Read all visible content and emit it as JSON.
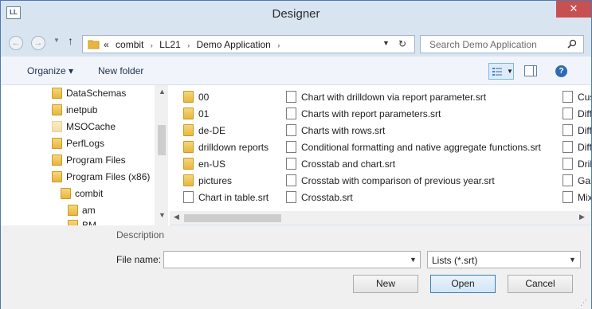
{
  "window": {
    "title": "Designer",
    "app_icon_text": "LL",
    "close_glyph": "✕"
  },
  "nav": {
    "back_glyph": "←",
    "forward_glyph": "→",
    "recent_glyph": "▼",
    "up_glyph": "↑",
    "breadcrumb_overflow": "«",
    "breadcrumb": [
      "combit",
      "LL21",
      "Demo Application"
    ],
    "breadcrumb_sep": "›",
    "dropdown_glyph": "▼",
    "refresh_glyph": "↻",
    "search_placeholder": "Search Demo Application"
  },
  "toolbar": {
    "organize_label": "Organize ▾",
    "new_folder_label": "New folder",
    "view_dropdown_glyph": "▼",
    "help_glyph": "?"
  },
  "navpane": {
    "items": [
      {
        "label": "DataSchemas",
        "icon": "folder-icon"
      },
      {
        "label": "inetpub",
        "icon": "folder-icon"
      },
      {
        "label": "MSOCache",
        "icon": "folder-faded-icon"
      },
      {
        "label": "PerfLogs",
        "icon": "folder-icon"
      },
      {
        "label": "Program Files",
        "icon": "folder-icon"
      },
      {
        "label": "Program Files (x86)",
        "icon": "folder-icon"
      },
      {
        "label": "combit",
        "icon": "folder-icon"
      },
      {
        "label": "am",
        "icon": "folder-icon"
      },
      {
        "label": "BM",
        "icon": "folder-icon"
      }
    ],
    "scroll_up_glyph": "▲",
    "scroll_down_glyph": "▼"
  },
  "files": {
    "column1": [
      {
        "label": "00",
        "icon": "folder-icon"
      },
      {
        "label": "01",
        "icon": "folder-icon"
      },
      {
        "label": "de-DE",
        "icon": "folder-icon"
      },
      {
        "label": "drilldown reports",
        "icon": "folder-icon"
      },
      {
        "label": "en-US",
        "icon": "folder-icon"
      },
      {
        "label": "pictures",
        "icon": "folder-icon"
      },
      {
        "label": "Chart in table.srt",
        "icon": "document-icon"
      }
    ],
    "column2": [
      {
        "label": "Chart with drilldown via report parameter.srt",
        "icon": "document-icon"
      },
      {
        "label": "Charts with report parameters.srt",
        "icon": "document-icon"
      },
      {
        "label": "Charts with rows.srt",
        "icon": "document-icon"
      },
      {
        "label": "Conditional formatting and native aggregate functions.srt",
        "icon": "document-icon"
      },
      {
        "label": "Crosstab and chart.srt",
        "icon": "document-icon"
      },
      {
        "label": "Crosstab with comparison of previous year.srt",
        "icon": "document-icon"
      },
      {
        "label": "Crosstab.srt",
        "icon": "document-icon"
      }
    ],
    "column3": [
      {
        "label": "Cust",
        "icon": "document-icon"
      },
      {
        "label": "Diffe",
        "icon": "document-icon"
      },
      {
        "label": "Diffe",
        "icon": "document-icon"
      },
      {
        "label": "Diffe",
        "icon": "document-icon"
      },
      {
        "label": "Drill",
        "icon": "document-icon"
      },
      {
        "label": "Gant",
        "icon": "document-icon"
      },
      {
        "label": "Mixe",
        "icon": "document-icon"
      }
    ],
    "scroll_left_glyph": "◀",
    "scroll_right_glyph": "▶"
  },
  "bottom": {
    "description_label": "Description",
    "filename_label": "File name:",
    "filename_value": "",
    "filename_dropdown_glyph": "▼",
    "filetype_value": "Lists (*.srt)",
    "filetype_dropdown_glyph": "▼",
    "new_button": "New",
    "open_button": "Open",
    "cancel_button": "Cancel",
    "grip_glyph": "⋰"
  },
  "colors": {
    "chrome": "#d9e4f1",
    "close_red": "#c75050",
    "folder": "#e8b63c",
    "selection_blue": "#7eb4ea"
  }
}
